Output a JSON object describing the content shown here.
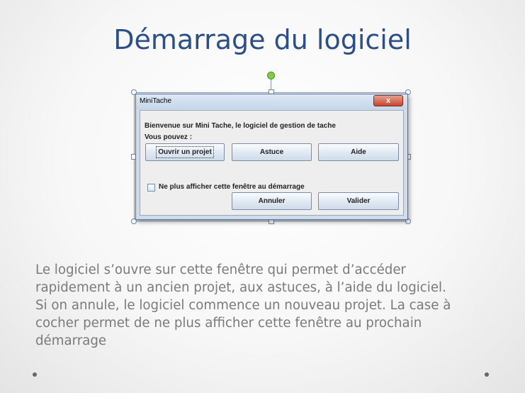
{
  "slide": {
    "title": "Démarrage du logiciel",
    "body_lines": [
      "Le logiciel s’ouvre sur cette fenêtre qui permet d’accéder",
      "rapidement à un ancien projet, aux astuces, à l’aide du logiciel.",
      "Si on annule, le logiciel commence un nouveau projet. La case à",
      "cocher permet de ne plus afficher cette fenêtre au prochain",
      "démarrage"
    ]
  },
  "dialog": {
    "window_title": "MiniTache",
    "close_glyph": "x",
    "welcome_text": "Bienvenue sur Mini Tache, le logiciel de gestion de tache",
    "options_label": "Vous pouvez :",
    "buttons": {
      "open_project": "Ouvrir un projet",
      "tips": "Astuce",
      "help": "Aide",
      "cancel": "Annuler",
      "validate": "Valider"
    },
    "checkbox": {
      "label": "Ne plus afficher cette fenêtre au démarrage",
      "checked": false
    }
  },
  "colors": {
    "title": "#2b4f86",
    "body_text": "#7a7a7a",
    "close_button": "#c8442d",
    "rotation_handle": "#7ed048"
  },
  "icons": [
    "close-icon",
    "rotation-handle-icon",
    "resize-handle-icon"
  ]
}
